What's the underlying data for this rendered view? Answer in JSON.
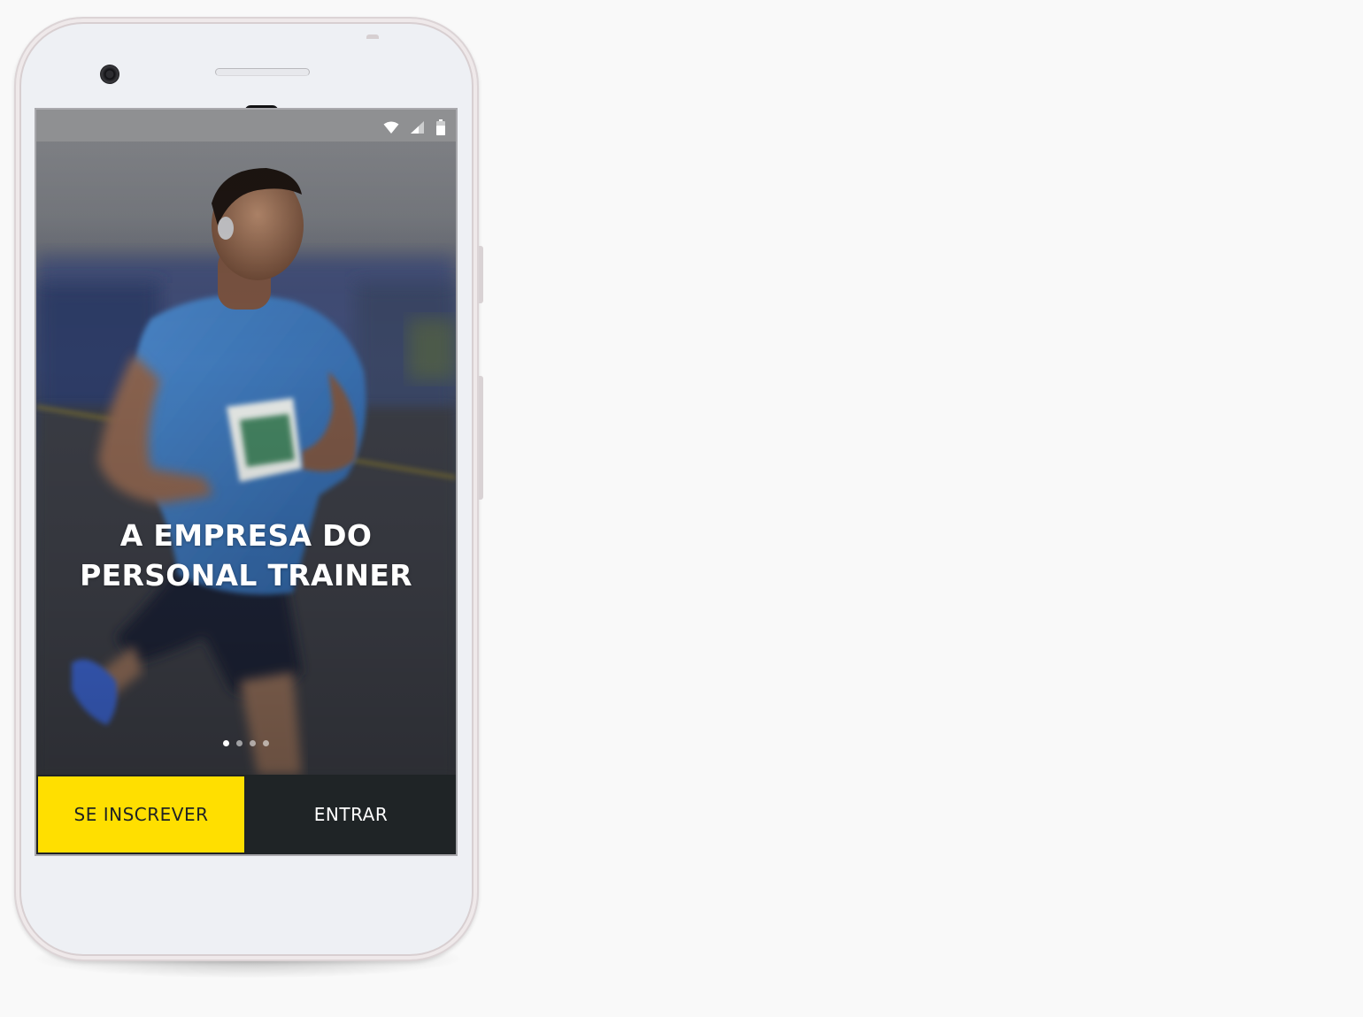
{
  "device": {
    "status_bar": {
      "icons": [
        "wifi-icon",
        "cellular-signal-icon",
        "battery-icon"
      ],
      "background": "#8f9092"
    }
  },
  "onboarding": {
    "headline": {
      "line1": "A EMPRESA DO",
      "line2": "PERSONAL TRAINER"
    },
    "carousel": {
      "total_pages": 4,
      "active_index": 0
    },
    "hero_image": "runner-photo"
  },
  "actions": {
    "signup_label": "SE INSCREVER",
    "login_label": "ENTRAR"
  },
  "colors": {
    "accent_yellow": "#ffdf00",
    "dark_button": "#1f2426",
    "headline_text": "#ffffff"
  }
}
